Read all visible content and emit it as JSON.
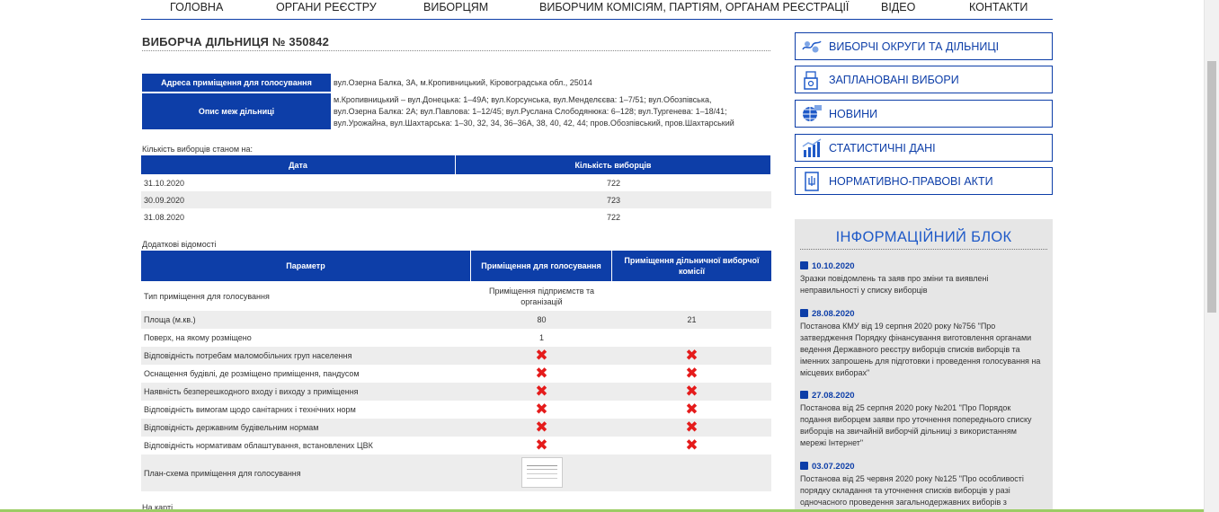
{
  "nav": [
    "ГОЛОВНА",
    "ОРГАНИ РЕЄСТРУ",
    "ВИБОРЦЯМ",
    "ВИБОРЧИМ КОМІСІЯМ, ПАРТІЯМ, ОРГАНАМ РЕЄСТРАЦІЇ",
    "ВІДЕО",
    "КОНТАКТИ"
  ],
  "page_title": "ВИБОРЧА ДІЛЬНИЦЯ № 350842",
  "address": {
    "label": "Адреса приміщення для голосування",
    "value": "вул.Озерна Балка, 3А, м.Кропивницький, Кіровоградська обл., 25014"
  },
  "boundary": {
    "label": "Опис меж дільниці",
    "line1": "м.Кропивницький – вул.Донецька: 1–49А; вул.Корсунська, вул.Менделєєва: 1–7/51; вул.Обозпівська,",
    "line2": "вул.Озерна Балка: 2А; вул.Павлова: 1–12/45; вул.Руслана Слободянюка: 6–128; вул.Тургенева: 1–18/41;",
    "line3": "вул.Урожайна, вул.Шахтарська: 1–30, 32, 34, 36–36А, 38, 40, 42, 44; пров.Обозпівський, пров.Шахтарський"
  },
  "voters_label": "Кількість виборців станом на:",
  "voters_headers": [
    "Дата",
    "Кількість виборців"
  ],
  "voters_rows": [
    {
      "date": "31.10.2020",
      "count": "722"
    },
    {
      "date": "30.09.2020",
      "count": "723"
    },
    {
      "date": "31.08.2020",
      "count": "722"
    }
  ],
  "extra_label": "Додаткові відомості",
  "params_headers": [
    "Параметр",
    "Приміщення для голосування",
    "Приміщення дільничної виборчої комісії"
  ],
  "params": {
    "type": {
      "name": "Тип приміщення для голосування",
      "val1": "Приміщення підприємств та організацій",
      "val2": ""
    },
    "area": {
      "name": "Площа (м.кв.)",
      "val1": "80",
      "val2": "21"
    },
    "floor": {
      "name": "Поверх, на якому розміщено",
      "val1": "1",
      "val2": ""
    },
    "mobility": {
      "name": "Відповідність потребам маломобільних груп населення"
    },
    "ramp": {
      "name": "Оснащення будівлі, де розміщено приміщення, пандусом"
    },
    "access": {
      "name": "Наявність безперешкодного входу і виходу з приміщення"
    },
    "sanitary": {
      "name": "Відповідність вимогам щодо санітарних і технічних норм"
    },
    "building": {
      "name": "Відповідність державним будівельним нормам"
    },
    "equipment": {
      "name": "Відповідність нормативам облаштування, встановлених ЦВК"
    },
    "plan": {
      "name": "План-схема приміщення для голосування"
    }
  },
  "cross_mark": "✖",
  "map_label": "На карті",
  "sidebar": {
    "districts": "ВИБОРЧІ ОКРУГИ ТА ДІЛЬНИЦІ",
    "elections": "ЗАПЛАНОВАНІ ВИБОРИ",
    "news": "НОВИНИ",
    "stats": "СТАТИСТИЧНІ ДАНІ",
    "legal": "НОРМАТИВНО-ПРАВОВІ АКТИ"
  },
  "info_title": "ІНФОРМАЦІЙНИЙ БЛОК",
  "news": [
    {
      "date": "10.10.2020",
      "text": "Зразки повідомлень та заяв про зміни та виявлені неправильності у списку виборців"
    },
    {
      "date": "28.08.2020",
      "text": "Постанова КМУ від 19 серпня 2020 року №756 \"Про затвердження Порядку фінансування виготовлення органами ведення Державного реєстру виборців списків виборців та іменних запрошень для підготовки і проведення голосування на місцевих виборах\""
    },
    {
      "date": "27.08.2020",
      "text": "Постанова від 25 серпня 2020 року №201 \"Про Порядок подання виборцем заяви про уточнення попереднього списку виборців на звичайній виборчій дільниці з використанням мережі Інтернет\""
    },
    {
      "date": "03.07.2020",
      "text": "Постанова від 25 червня 2020 року №125 \"Про особливості порядку складання та уточнення списків виборців у разі одночасного проведення загальнодержавних виборів з"
    }
  ],
  "colors": {
    "primary": "#0d3ea8",
    "cross": "#e51b1b",
    "info_bg": "#e6e6e6"
  }
}
